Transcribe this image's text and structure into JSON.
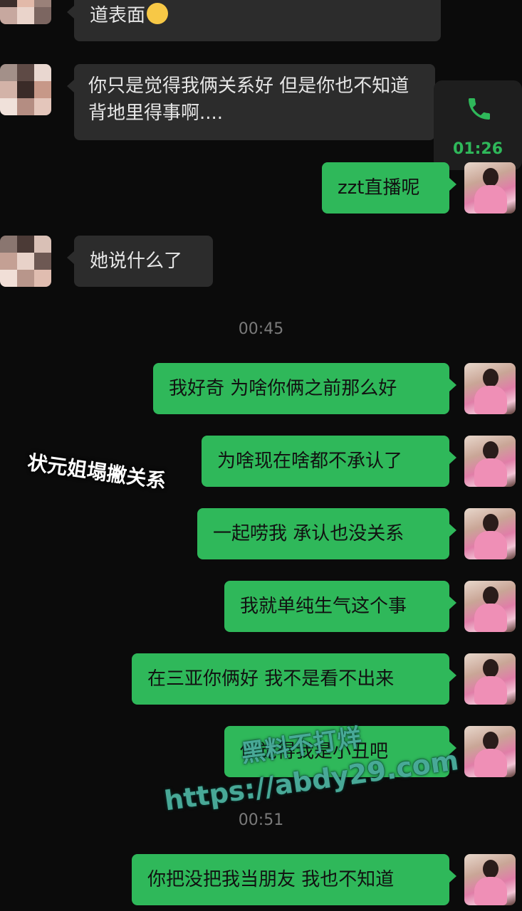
{
  "messages": {
    "m1": "道表面",
    "m2": "你只是觉得我俩关系好 但是你也不知道背地里得事啊....",
    "m3": "zzt直播呢",
    "m4": "她说什么了",
    "m5": "我好奇 为啥你俩之前那么好",
    "m6": "为啥现在啥都不承认了",
    "m7": "一起唠我 承认也没关系",
    "m8": "我就单纯生气这个事",
    "m9": "在三亚你俩好 我不是看不出来",
    "m10": "你觉得我是小丑吧",
    "m11": "你把没把我当朋友 我也不知道"
  },
  "emoji": "crying-face-icon",
  "call": {
    "duration": "01:26",
    "icon": "phone-icon"
  },
  "timestamps": {
    "t1": "00:45",
    "t2": "00:51"
  },
  "overlay": {
    "caption": "状元姐塌撇关系"
  },
  "watermark": {
    "title": "黑料不打烊",
    "url": "https://abdy29.com"
  },
  "colors": {
    "background": "#0b0b0b",
    "incoming_bubble": "#2c2c2c",
    "outgoing_bubble": "#2fb85a",
    "accent_green": "#2fb85a",
    "timestamp_text": "#7a7a7a"
  }
}
